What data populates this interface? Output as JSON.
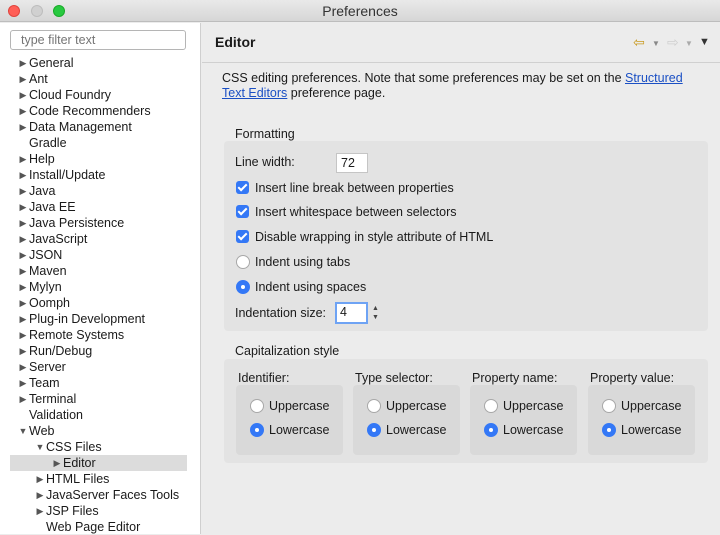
{
  "window": {
    "title": "Preferences"
  },
  "sidebar": {
    "filter_placeholder": "type filter text",
    "items": [
      {
        "label": "General",
        "arrow": "▶",
        "indent": 0
      },
      {
        "label": "Ant",
        "arrow": "▶",
        "indent": 0
      },
      {
        "label": "Cloud Foundry",
        "arrow": "▶",
        "indent": 0
      },
      {
        "label": "Code Recommenders",
        "arrow": "▶",
        "indent": 0
      },
      {
        "label": "Data Management",
        "arrow": "▶",
        "indent": 0
      },
      {
        "label": "Gradle",
        "arrow": "",
        "indent": 0
      },
      {
        "label": "Help",
        "arrow": "▶",
        "indent": 0
      },
      {
        "label": "Install/Update",
        "arrow": "▶",
        "indent": 0
      },
      {
        "label": "Java",
        "arrow": "▶",
        "indent": 0
      },
      {
        "label": "Java EE",
        "arrow": "▶",
        "indent": 0
      },
      {
        "label": "Java Persistence",
        "arrow": "▶",
        "indent": 0
      },
      {
        "label": "JavaScript",
        "arrow": "▶",
        "indent": 0
      },
      {
        "label": "JSON",
        "arrow": "▶",
        "indent": 0
      },
      {
        "label": "Maven",
        "arrow": "▶",
        "indent": 0
      },
      {
        "label": "Mylyn",
        "arrow": "▶",
        "indent": 0
      },
      {
        "label": "Oomph",
        "arrow": "▶",
        "indent": 0
      },
      {
        "label": "Plug-in Development",
        "arrow": "▶",
        "indent": 0
      },
      {
        "label": "Remote Systems",
        "arrow": "▶",
        "indent": 0
      },
      {
        "label": "Run/Debug",
        "arrow": "▶",
        "indent": 0
      },
      {
        "label": "Server",
        "arrow": "▶",
        "indent": 0
      },
      {
        "label": "Team",
        "arrow": "▶",
        "indent": 0
      },
      {
        "label": "Terminal",
        "arrow": "▶",
        "indent": 0
      },
      {
        "label": "Validation",
        "arrow": "",
        "indent": 0
      },
      {
        "label": "Web",
        "arrow": "▼",
        "indent": 0
      },
      {
        "label": "CSS Files",
        "arrow": "▼",
        "indent": 1
      },
      {
        "label": "Editor",
        "arrow": "▶",
        "indent": 2,
        "selected": true
      },
      {
        "label": "HTML Files",
        "arrow": "▶",
        "indent": 1
      },
      {
        "label": "JavaServer Faces Tools",
        "arrow": "▶",
        "indent": 1
      },
      {
        "label": "JSP Files",
        "arrow": "▶",
        "indent": 1
      },
      {
        "label": "Web Page Editor",
        "arrow": "",
        "indent": 1
      }
    ]
  },
  "header": {
    "title": "Editor",
    "back_icon": "back-arrow-icon",
    "forward_icon": "forward-arrow-icon",
    "menu_icon": "view-menu-icon"
  },
  "description": {
    "text": "CSS editing preferences.  Note that some preferences may be set on the ",
    "link": "Structured Text Editors",
    "suffix": " preference page."
  },
  "formatting": {
    "label": "Formatting",
    "line_width_label": "Line width:",
    "line_width_value": "72",
    "checks": [
      {
        "label": "Insert line break between properties",
        "checked": true
      },
      {
        "label": "Insert whitespace between selectors",
        "checked": true
      },
      {
        "label": "Disable wrapping in style attribute of HTML",
        "checked": true
      }
    ],
    "indent_options": [
      {
        "label": "Indent using tabs",
        "selected": false
      },
      {
        "label": "Indent using spaces",
        "selected": true
      }
    ],
    "indent_size_label": "Indentation size:",
    "indent_size_value": "4"
  },
  "capitalization": {
    "label": "Capitalization style",
    "groups": [
      {
        "title": "Identifier:",
        "options": [
          "Uppercase",
          "Lowercase"
        ],
        "selected": "Lowercase"
      },
      {
        "title": "Type selector:",
        "options": [
          "Uppercase",
          "Lowercase"
        ],
        "selected": "Lowercase"
      },
      {
        "title": "Property name:",
        "options": [
          "Uppercase",
          "Lowercase"
        ],
        "selected": "Lowercase"
      },
      {
        "title": "Property value:",
        "options": [
          "Uppercase",
          "Lowercase"
        ],
        "selected": "Lowercase"
      }
    ]
  },
  "colors": {
    "accent": "#3478f6",
    "link": "#1a4fc4",
    "selection": "#dcdcdc"
  }
}
